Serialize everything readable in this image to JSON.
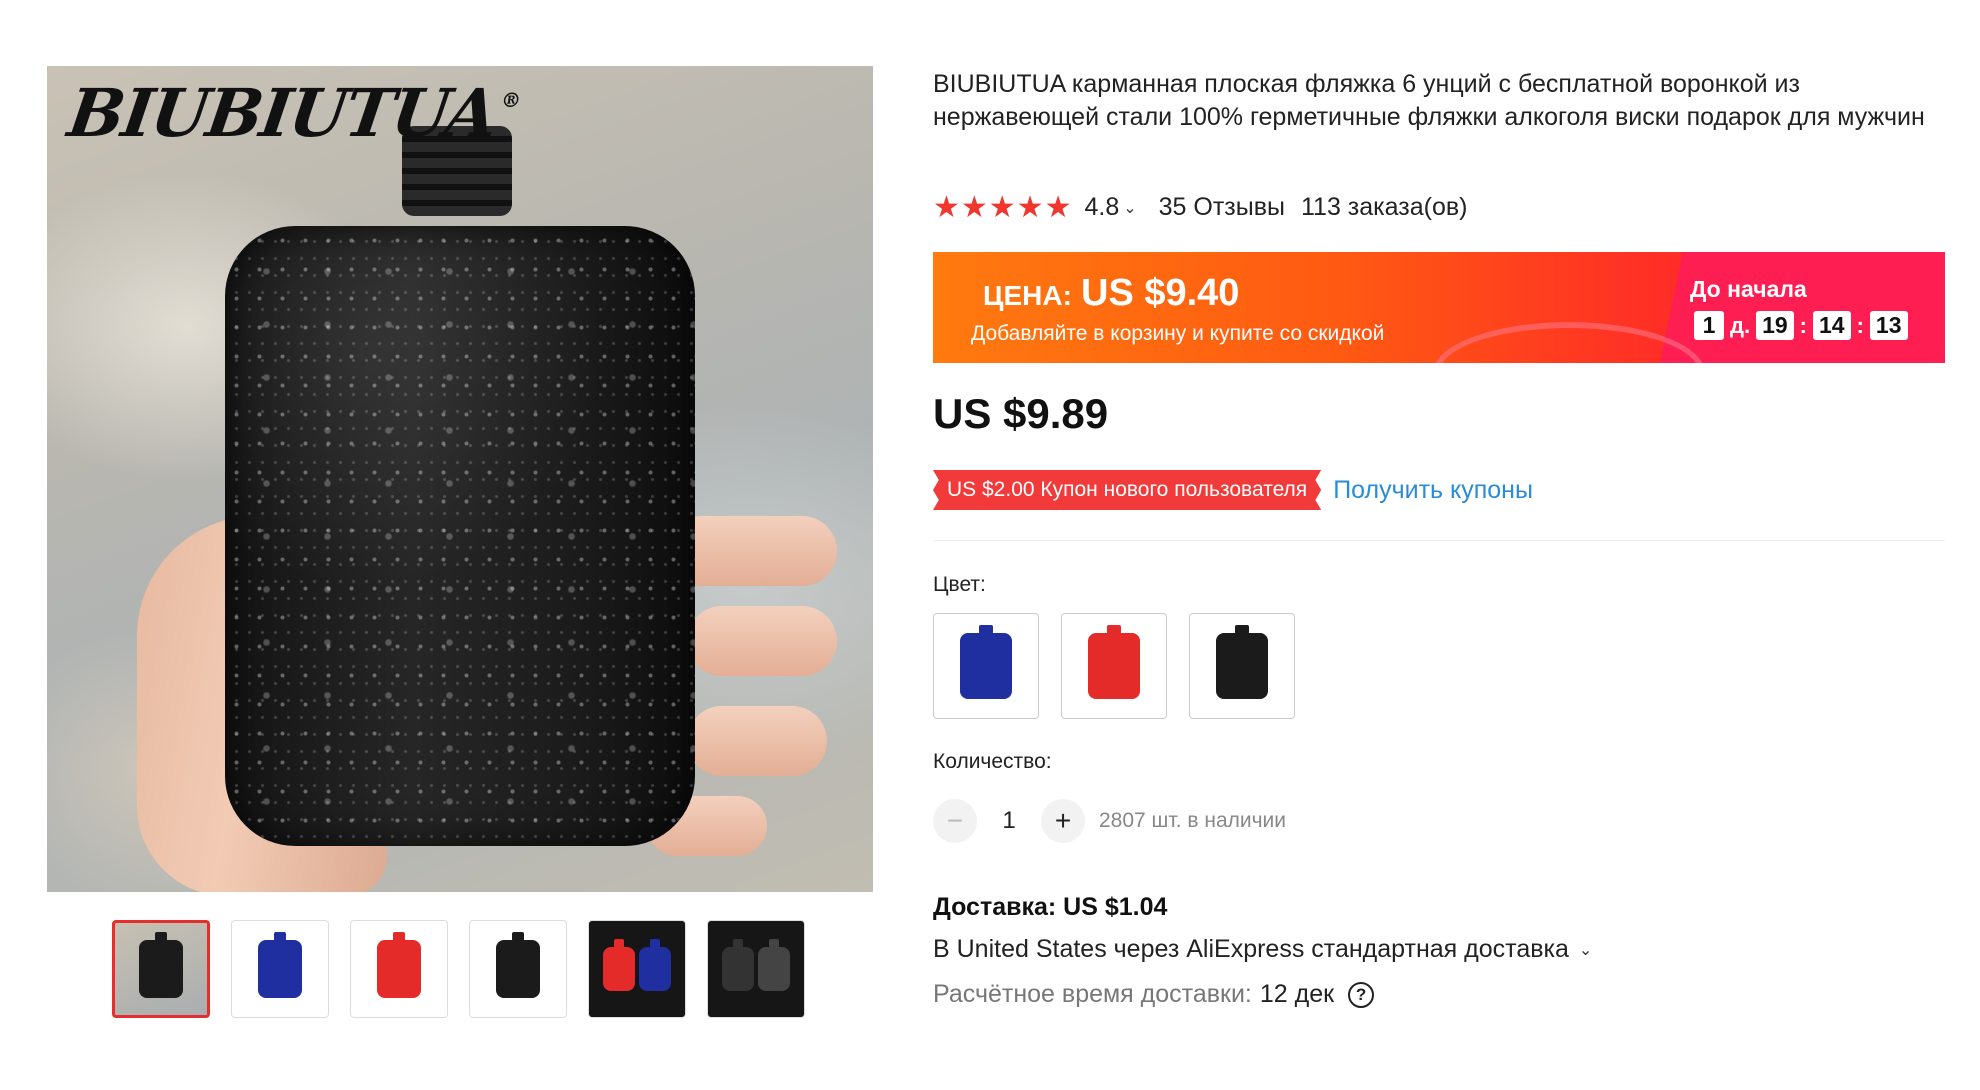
{
  "gallery": {
    "brand_logo": "BIUBIUTUA",
    "brand_mark": "®",
    "thumbnails": [
      {
        "label": "photo-hand",
        "active": true
      },
      {
        "label": "blue"
      },
      {
        "label": "red"
      },
      {
        "label": "black"
      },
      {
        "label": "red-blue-pair"
      },
      {
        "label": "black-pair"
      }
    ]
  },
  "product": {
    "title": "BIUBIUTUA карманная плоская фляжка 6 унций с бесплатной воронкой из нержавеющей стали 100% герметичные фляжки алкоголя виски подарок для мужчин",
    "stars": "★★★★★",
    "rating": "4.8",
    "reviews": "35 Отзывы",
    "orders": "113 заказа(ов)"
  },
  "promo": {
    "label": "ЦЕНА:",
    "price": "US $9.40",
    "subtitle": "Добавляйте в корзину и купите со скидкой",
    "countdown_title": "До начала",
    "days": "1",
    "days_unit": "д.",
    "hours": "19",
    "minutes": "14",
    "seconds": "13",
    "colors": {
      "start": "#ff7a0f",
      "end": "#ff1e52"
    }
  },
  "price": {
    "current": "US $9.89"
  },
  "coupon": {
    "tag": "US $2.00 Купон нового пользователя",
    "link": "Получить купоны"
  },
  "options": {
    "color_label": "Цвет:",
    "colors": [
      {
        "name": "blue",
        "hex": "#1f2fa0"
      },
      {
        "name": "red",
        "hex": "#e52a2a"
      },
      {
        "name": "black",
        "hex": "#1b1b1b"
      }
    ]
  },
  "quantity": {
    "label": "Количество:",
    "minus": "−",
    "plus": "+",
    "value": "1",
    "stock": "2807 шт. в наличии"
  },
  "delivery": {
    "title": "Доставка: US $1.04",
    "method": "В United States через AliExpress стандартная доставка",
    "time_label": "Расчётное время доставки:",
    "date": "12 дек",
    "help": "?"
  },
  "icons": {
    "chevron": "chevron-down-icon",
    "help": "question-circle-icon"
  }
}
